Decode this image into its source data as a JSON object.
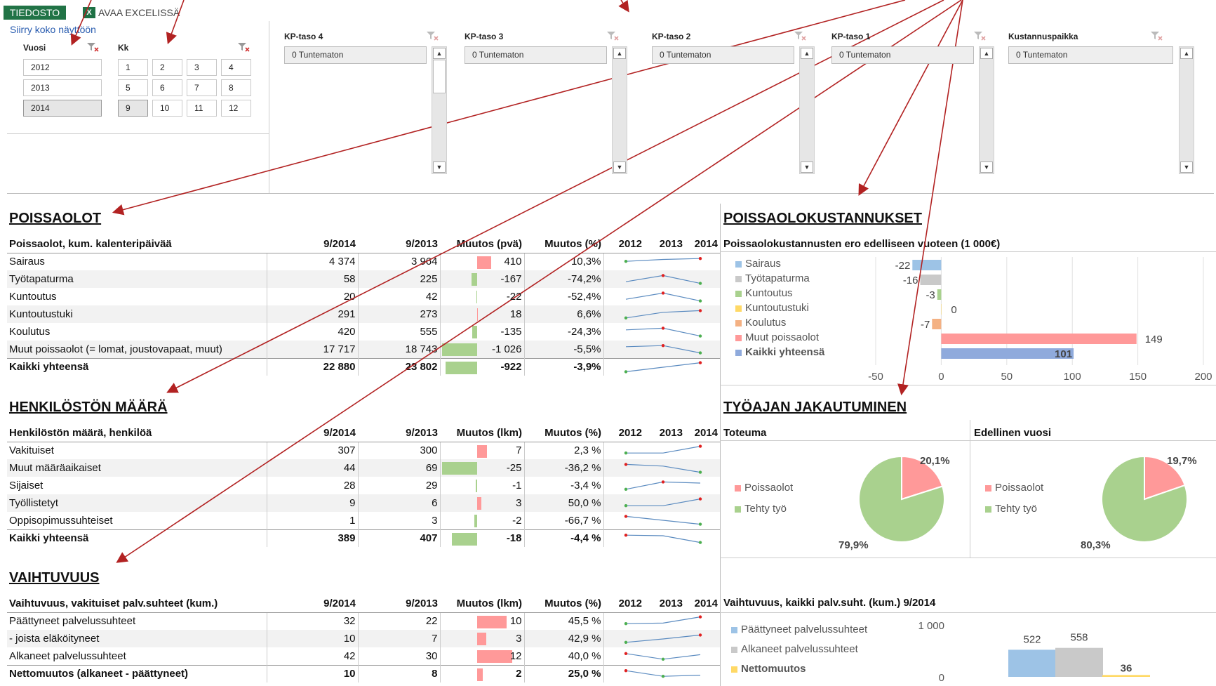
{
  "topbar": {
    "file_label": "TIEDOSTO",
    "excel_label": "AVAA EXCELISSÄ",
    "excel_icon": "X",
    "fullscreen_link": "Siirry koko näyttöön"
  },
  "slicers": {
    "year": {
      "title": "Vuosi",
      "items": [
        "2012",
        "2013",
        "2014"
      ],
      "selected": "2014"
    },
    "month": {
      "title": "Kk",
      "items": [
        "1",
        "2",
        "3",
        "4",
        "5",
        "6",
        "7",
        "8",
        "9",
        "10",
        "11",
        "12"
      ],
      "selected": "9"
    },
    "lists": [
      {
        "title": "KP-taso 4",
        "item": "0 Tuntematon"
      },
      {
        "title": "KP-taso 3",
        "item": "0 Tuntematon"
      },
      {
        "title": "KP-taso 2",
        "item": "0 Tuntematon"
      },
      {
        "title": "KP-taso 1",
        "item": "0 Tuntematon"
      },
      {
        "title": "Kustannuspaikka",
        "item": "0 Tuntematon"
      }
    ],
    "scroll_up": "▲",
    "scroll_down": "▼"
  },
  "poissaolot": {
    "section_title": "POISSAOLOT",
    "headers": [
      "Poissaolot, kum. kalenteripäivää",
      "9/2014",
      "9/2013",
      "Muutos (pvä)",
      "Muutos (%)",
      "2012",
      "2013",
      "2014"
    ],
    "rows": [
      {
        "label": "Sairaus",
        "a": "4 374",
        "b": "3 964",
        "c": "410",
        "d": "10,3%",
        "change": 410,
        "spark": [
          0.55,
          0.72,
          0.8
        ]
      },
      {
        "label": "Työtapaturma",
        "a": "58",
        "b": "225",
        "c": "-167",
        "d": "-74,2%",
        "change": -167,
        "spark": [
          0.3,
          0.85,
          0.15
        ]
      },
      {
        "label": "Kuntoutus",
        "a": "20",
        "b": "42",
        "c": "-22",
        "d": "-52,4%",
        "change": -22,
        "spark": [
          0.3,
          0.85,
          0.15
        ]
      },
      {
        "label": "Kuntoutustuki",
        "a": "291",
        "b": "273",
        "c": "18",
        "d": "6,6%",
        "change": 18,
        "spark": [
          0.2,
          0.7,
          0.85
        ]
      },
      {
        "label": "Koulutus",
        "a": "420",
        "b": "555",
        "c": "-135",
        "d": "-24,3%",
        "change": -135,
        "spark": [
          0.7,
          0.85,
          0.15
        ]
      },
      {
        "label": "Muut poissaolot (= lomat, joustovapaat, muut)",
        "a": "17 717",
        "b": "18 743",
        "c": "-1 026",
        "d": "-5,5%",
        "change": -1026,
        "spark": [
          0.7,
          0.8,
          0.15
        ]
      },
      {
        "label": "Kaikki yhteensä",
        "a": "22 880",
        "b": "23 802",
        "c": "-922",
        "d": "-3,9%",
        "change": -922,
        "spark": [
          0.1,
          0.5,
          0.9
        ]
      }
    ]
  },
  "henkilosto": {
    "section_title": "HENKILÖSTÖN MÄÄRÄ",
    "headers": [
      "Henkilöstön määrä, henkilöä",
      "9/2014",
      "9/2013",
      "Muutos (lkm)",
      "Muutos (%)",
      "2012",
      "2013",
      "2014"
    ],
    "rows": [
      {
        "label": "Vakituiset",
        "a": "307",
        "b": "300",
        "c": "7",
        "d": "2,3 %",
        "change": 7,
        "spark": [
          0.3,
          0.3,
          0.9
        ]
      },
      {
        "label": "Muut määräaikaiset",
        "a": "44",
        "b": "69",
        "c": "-25",
        "d": "-36,2 %",
        "change": -25,
        "spark": [
          0.85,
          0.7,
          0.15
        ]
      },
      {
        "label": "Sijaiset",
        "a": "28",
        "b": "29",
        "c": "-1",
        "d": "-3,4 %",
        "change": -1,
        "spark": [
          0.2,
          0.85,
          0.75
        ]
      },
      {
        "label": "Työllistetyt",
        "a": "9",
        "b": "6",
        "c": "3",
        "d": "50,0 %",
        "change": 3,
        "spark": [
          0.3,
          0.3,
          0.9
        ]
      },
      {
        "label": "Oppisopimussuhteiset",
        "a": "1",
        "b": "3",
        "c": "-2",
        "d": "-66,7 %",
        "change": -2,
        "spark": [
          0.85,
          0.5,
          0.15
        ]
      },
      {
        "label": "Kaikki yhteensä",
        "a": "389",
        "b": "407",
        "c": "-18",
        "d": "-4,4 %",
        "change": -18,
        "spark": [
          0.8,
          0.75,
          0.15
        ]
      }
    ]
  },
  "vaihtuvuus": {
    "section_title": "VAIHTUVUUS",
    "headers": [
      "Vaihtuvuus, vakituiset palv.suhteet (kum.)",
      "9/2014",
      "9/2013",
      "Muutos (lkm)",
      "Muutos (%)",
      "2012",
      "2013",
      "2014"
    ],
    "rows": [
      {
        "label": "Päättyneet palvelussuhteet",
        "a": "32",
        "b": "22",
        "c": "10",
        "d": "45,5 %",
        "change": 10,
        "spark": [
          0.3,
          0.35,
          0.9
        ]
      },
      {
        "label": "- joista eläköityneet",
        "a": "10",
        "b": "7",
        "c": "3",
        "d": "42,9 %",
        "change": 3,
        "spark": [
          0.2,
          0.5,
          0.85
        ]
      },
      {
        "label": "Alkaneet palvelussuhteet",
        "a": "42",
        "b": "30",
        "c": "12",
        "d": "40,0 %",
        "change": 12,
        "spark": [
          0.7,
          0.2,
          0.6
        ]
      },
      {
        "label": "Nettomuutos (alkaneet - päättyneet)",
        "a": "10",
        "b": "8",
        "c": "2",
        "d": "25,0 %",
        "change": 2,
        "spark": [
          0.8,
          0.3,
          0.4
        ]
      }
    ]
  },
  "kustannukset": {
    "section_title": "POISSAOLOKUSTANNUKSET",
    "chart_title": "Poissaolokustannusten ero edelliseen vuoteen (1 000€)"
  },
  "tyoaika": {
    "section_title": "TYÖAJAN JAKAUTUMINEN",
    "left_title": "Toteuma",
    "right_title": "Edellinen vuosi"
  },
  "vaihtuvuus_chart": {
    "title": "Vaihtuvuus, kaikki palv.suht. (kum.) 9/2014"
  },
  "chart_data": [
    {
      "type": "bar",
      "orientation": "horizontal",
      "title": "Poissaolokustannusten ero edelliseen vuoteen (1 000€)",
      "categories": [
        "Sairaus",
        "Työtapaturma",
        "Kuntoutus",
        "Kuntoutustuki",
        "Koulutus",
        "Muut poissaolot",
        "Kaikki yhteensä"
      ],
      "values": [
        -22,
        -16,
        -3,
        0,
        -7,
        149,
        101
      ],
      "colors": [
        "#9dc3e6",
        "#c9c9c9",
        "#a9d18e",
        "#ffd966",
        "#f4b183",
        "#ff9999",
        "#8faadc"
      ],
      "xlim": [
        -50,
        200
      ],
      "xticks": [
        "-50",
        "0",
        "50",
        "100",
        "150",
        "200"
      ],
      "grid": true,
      "legend": "left"
    },
    {
      "type": "pie",
      "title": "Toteuma",
      "labels": [
        "Poissaolot",
        "Tehty työ"
      ],
      "values": [
        20.1,
        79.9
      ],
      "value_labels": [
        "20,1%",
        "79,9%"
      ],
      "colors": [
        "#ff9999",
        "#a9d18e"
      ]
    },
    {
      "type": "pie",
      "title": "Edellinen vuosi",
      "labels": [
        "Poissaolot",
        "Tehty työ"
      ],
      "values": [
        19.7,
        80.3
      ],
      "value_labels": [
        "19,7%",
        "80,3%"
      ],
      "colors": [
        "#ff9999",
        "#a9d18e"
      ]
    },
    {
      "type": "bar",
      "title": "Vaihtuvuus, kaikki palv.suht. (kum.) 9/2014",
      "categories": [
        "Päättyneet palvelussuhteet",
        "Alkaneet palvelussuhteet",
        "Nettomuutos"
      ],
      "values": [
        522,
        558,
        36
      ],
      "colors": [
        "#9dc3e6",
        "#c9c9c9",
        "#ffd966"
      ],
      "ylim": [
        0,
        1000
      ],
      "yticks": [
        "1 000",
        "0"
      ],
      "legend": "left"
    }
  ]
}
